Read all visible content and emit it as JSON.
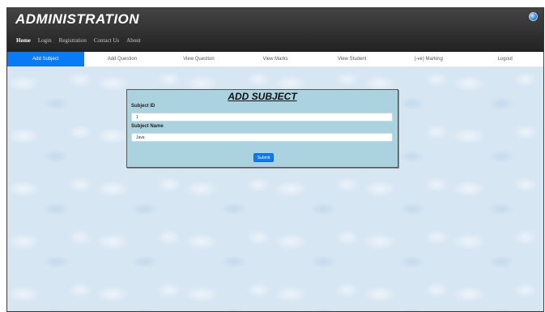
{
  "app": {
    "title": "ADMINISTRATION",
    "globe_icon": "globe-icon"
  },
  "top_nav": {
    "items": [
      {
        "label": "Home",
        "active": true
      },
      {
        "label": "Login"
      },
      {
        "label": "Registration"
      },
      {
        "label": "Contact Us"
      },
      {
        "label": "About"
      }
    ]
  },
  "sub_nav": {
    "tabs": [
      {
        "label": "Add Subject",
        "active": true
      },
      {
        "label": "Add Question"
      },
      {
        "label": "View Question"
      },
      {
        "label": "View Marks"
      },
      {
        "label": "View Student"
      },
      {
        "label": "(-ve) Marking"
      },
      {
        "label": "Logout"
      }
    ]
  },
  "form": {
    "title": "ADD SUBJECT",
    "subject_id_label": "Subject ID",
    "subject_id_value": "1",
    "subject_name_label": "Subject Name",
    "subject_name_value": "Java",
    "submit_label": "Submit"
  },
  "colors": {
    "accent": "#0a7bf7",
    "panel": "#aad3df",
    "header": "#333333"
  }
}
